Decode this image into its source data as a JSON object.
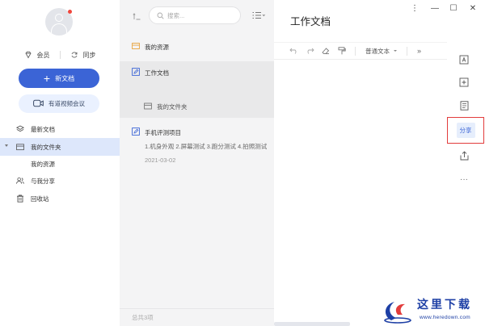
{
  "sidebar": {
    "member_label": "会员",
    "sync_label": "同步",
    "new_doc_label": "新文档",
    "meeting_label": "有道视频会议",
    "nav": [
      {
        "label": "最新文档"
      },
      {
        "label": "我的文件夹"
      },
      {
        "label": "我的资源"
      },
      {
        "label": "与我分享"
      },
      {
        "label": "回收站"
      }
    ]
  },
  "file_list": {
    "search_placeholder": "搜索...",
    "items": [
      {
        "title": "我的资源"
      },
      {
        "title": "工作文档"
      },
      {
        "title": "我的文件夹"
      },
      {
        "title": "手机评测项目",
        "desc": "1.机身外观 2.屏幕测试 3.跑分测试 4.拍照测试",
        "date": "2021-03-02"
      }
    ],
    "footer": "总共3项"
  },
  "editor": {
    "title": "工作文档",
    "paragraph_style": "普通文本",
    "more": "»",
    "share_label": "分享",
    "more_dots": "···"
  },
  "window": {
    "menu": "⋮",
    "minimize": "—",
    "maximize": "☐",
    "close": "✕"
  },
  "watermark": {
    "text": "这里下载",
    "url": "www.heredown.com"
  },
  "colors": {
    "accent": "#3b64d6",
    "active_nav": "#dde7fb",
    "highlight_border": "#e23c3c"
  }
}
